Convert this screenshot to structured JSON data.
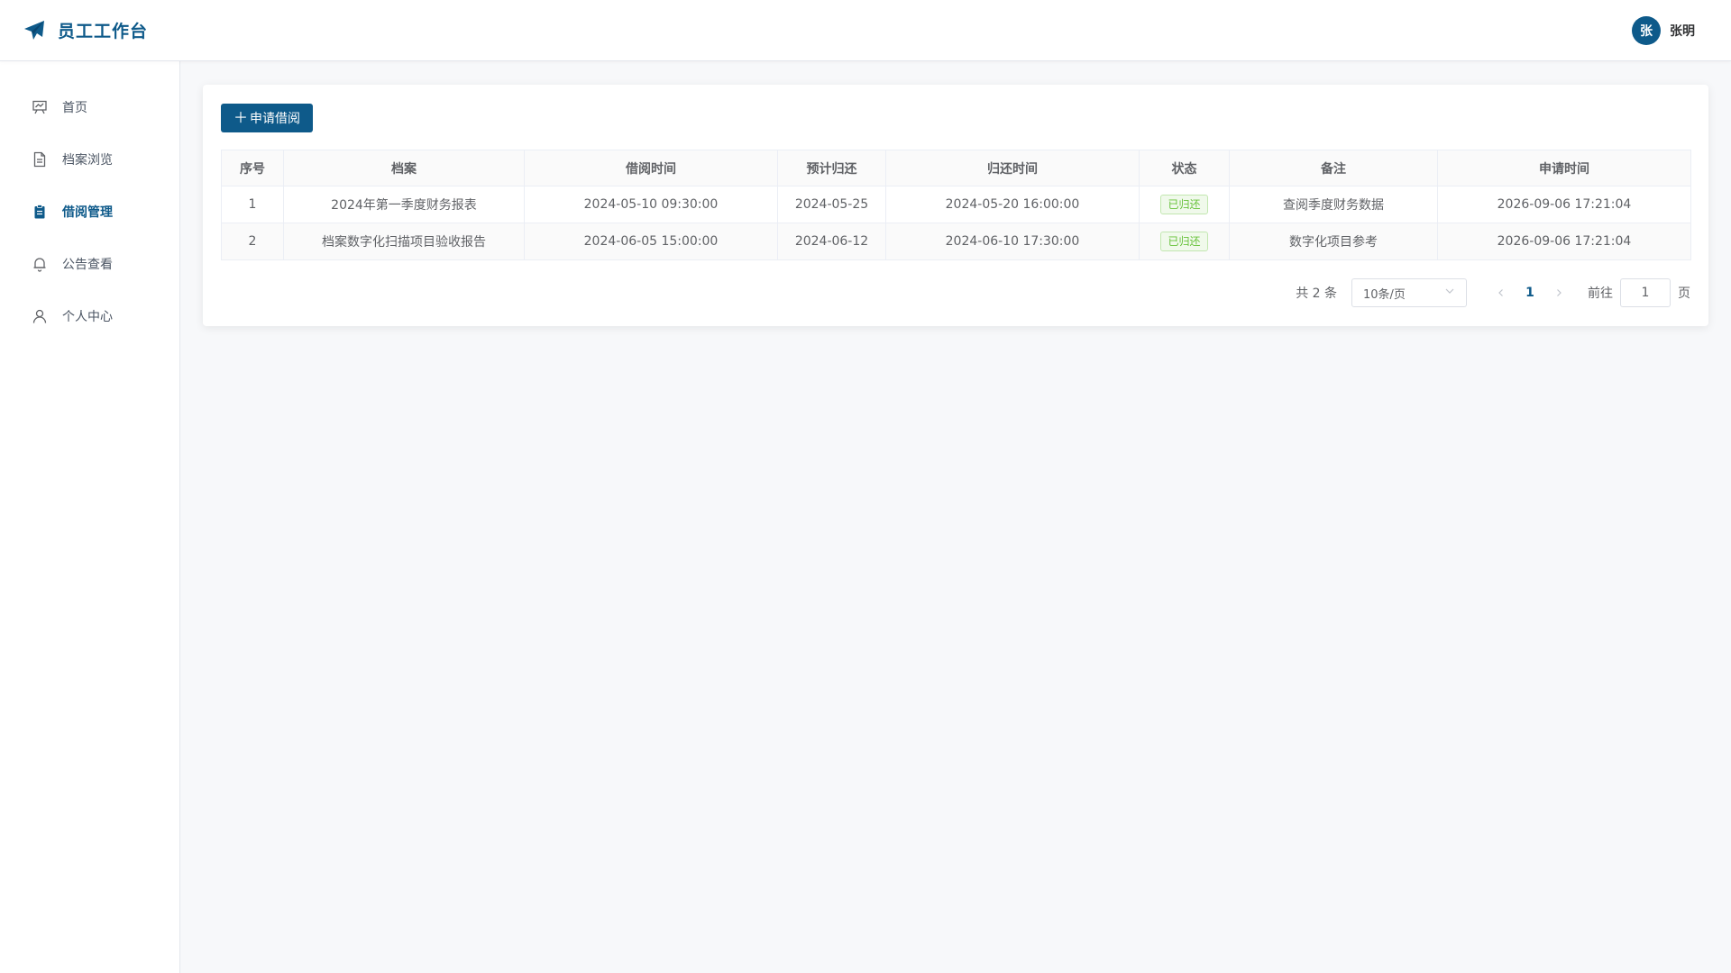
{
  "header": {
    "title": "员工工作台",
    "user_avatar": "张",
    "user_name": "张明"
  },
  "sidebar": {
    "items": [
      {
        "label": "首页",
        "icon": "presentation-icon"
      },
      {
        "label": "档案浏览",
        "icon": "document-icon"
      },
      {
        "label": "借阅管理",
        "icon": "clipboard-icon",
        "active": true
      },
      {
        "label": "公告查看",
        "icon": "bell-icon"
      },
      {
        "label": "个人中心",
        "icon": "user-icon"
      }
    ]
  },
  "toolbar": {
    "apply_label": "申请借阅"
  },
  "table": {
    "headers": [
      "序号",
      "档案",
      "借阅时间",
      "预计归还",
      "归还时间",
      "状态",
      "备注",
      "申请时间"
    ],
    "rows": [
      {
        "index": "1",
        "archive": "2024年第一季度财务报表",
        "borrow_time": "2024-05-10 09:30:00",
        "expected_return": "2024-05-25",
        "return_time": "2024-05-20 16:00:00",
        "status": "已归还",
        "remark": "查阅季度财务数据",
        "apply_time": "2026-09-06 17:21:04"
      },
      {
        "index": "2",
        "archive": "档案数字化扫描项目验收报告",
        "borrow_time": "2024-06-05 15:00:00",
        "expected_return": "2024-06-12",
        "return_time": "2024-06-10 17:30:00",
        "status": "已归还",
        "remark": "数字化项目参考",
        "apply_time": "2026-09-06 17:21:04"
      }
    ]
  },
  "pagination": {
    "total": "共 2 条",
    "page_size": "10条/页",
    "current_page": "1",
    "goto_label": "前往",
    "goto_value": "1",
    "page_suffix": "页"
  },
  "colors": {
    "primary": "#0e5a8a",
    "success": "#67c23a"
  }
}
